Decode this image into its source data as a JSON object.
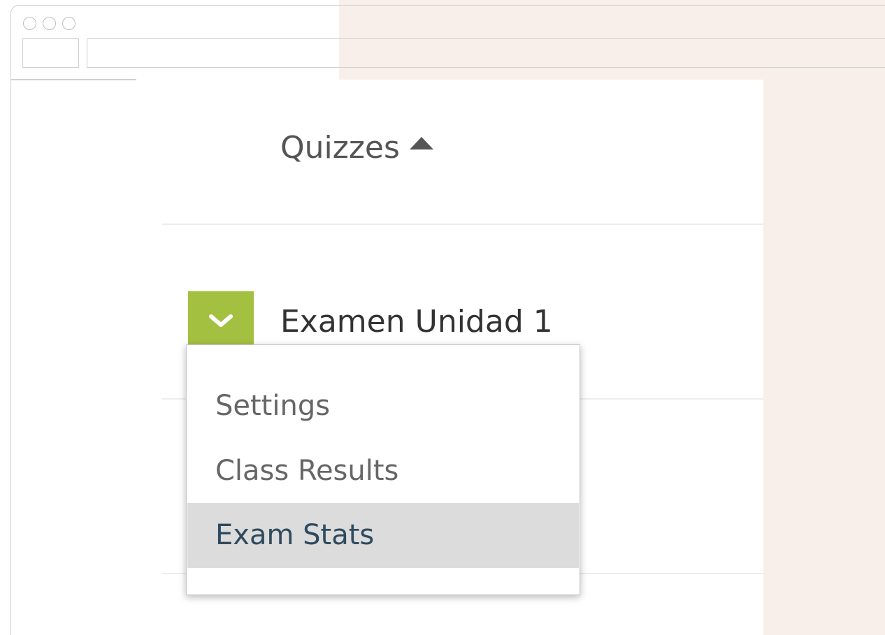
{
  "section": {
    "heading": "Quizzes",
    "sort_icon": "caret-up-icon"
  },
  "quiz": {
    "title": "Examen Unidad 1",
    "toggle_icon": "chevron-down-icon",
    "accent_color": "#a4c040"
  },
  "menu": {
    "items": [
      {
        "label": "Settings",
        "selected": false
      },
      {
        "label": "Class Results",
        "selected": false
      },
      {
        "label": "Exam Stats",
        "selected": true
      }
    ]
  },
  "colors": {
    "panel_background": "#f8efeb",
    "highlight": "#dcdcdc"
  }
}
